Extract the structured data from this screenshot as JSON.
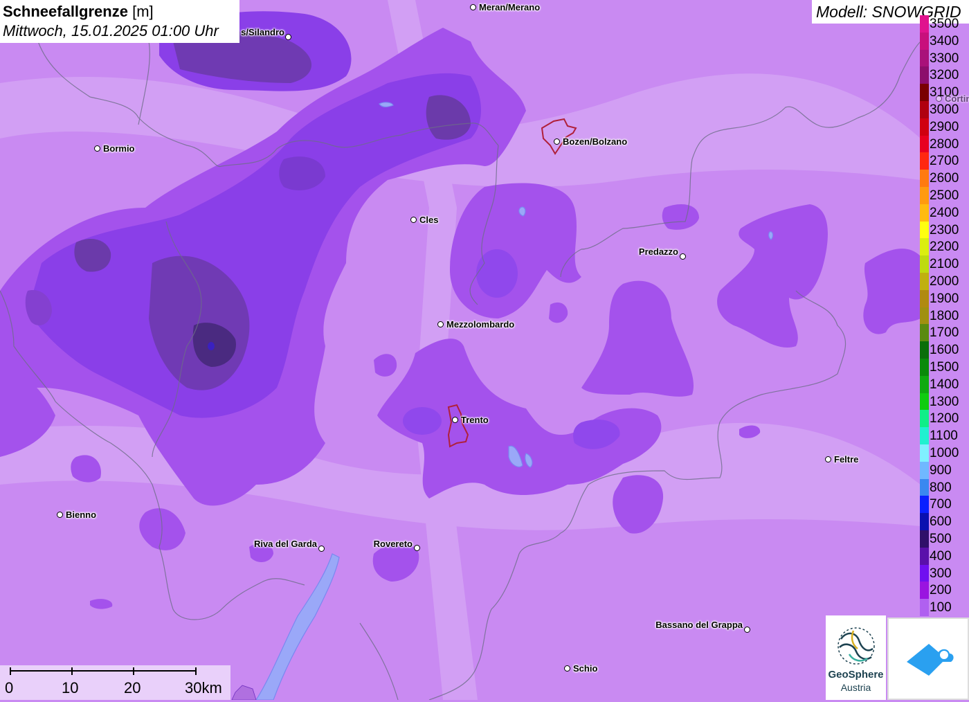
{
  "header": {
    "title_bold": "Schneefallgrenze",
    "title_unit": "[m]",
    "datetime": "Mittwoch, 15.01.2025 01:00 Uhr",
    "model": "Modell: SNOWGRID"
  },
  "legend": {
    "items": [
      {
        "label": "3500",
        "color": "#e0138e"
      },
      {
        "label": "3400",
        "color": "#c8107c"
      },
      {
        "label": "3300",
        "color": "#a9117a"
      },
      {
        "label": "3200",
        "color": "#8c0e6c"
      },
      {
        "label": "3100",
        "color": "#7a0000"
      },
      {
        "label": "3000",
        "color": "#b00010"
      },
      {
        "label": "2900",
        "color": "#d00010"
      },
      {
        "label": "2800",
        "color": "#e80020"
      },
      {
        "label": "2700",
        "color": "#ff2810"
      },
      {
        "label": "2600",
        "color": "#ff7a10"
      },
      {
        "label": "2500",
        "color": "#ff9a10"
      },
      {
        "label": "2400",
        "color": "#ffbb10"
      },
      {
        "label": "2300",
        "color": "#ffff10"
      },
      {
        "label": "2200",
        "color": "#dbee10"
      },
      {
        "label": "2100",
        "color": "#bedb10"
      },
      {
        "label": "2000",
        "color": "#c0b010"
      },
      {
        "label": "1900",
        "color": "#b08a10"
      },
      {
        "label": "1800",
        "color": "#a09010"
      },
      {
        "label": "1700",
        "color": "#5a8a10"
      },
      {
        "label": "1600",
        "color": "#0a6e0a"
      },
      {
        "label": "1500",
        "color": "#0a8a0a"
      },
      {
        "label": "1400",
        "color": "#10aa10"
      },
      {
        "label": "1300",
        "color": "#10cc10"
      },
      {
        "label": "1200",
        "color": "#10ee88"
      },
      {
        "label": "1100",
        "color": "#20f0d0"
      },
      {
        "label": "1000",
        "color": "#80f0ff"
      },
      {
        "label": "900",
        "color": "#70b8ff"
      },
      {
        "label": "800",
        "color": "#3a88f0"
      },
      {
        "label": "700",
        "color": "#0a20ff"
      },
      {
        "label": "600",
        "color": "#0a10b0"
      },
      {
        "label": "500",
        "color": "#30106a"
      },
      {
        "label": "400",
        "color": "#5a10aa"
      },
      {
        "label": "300",
        "color": "#7010f0"
      },
      {
        "label": "200",
        "color": "#9a14e0"
      },
      {
        "label": "100",
        "color": "#b060f0"
      }
    ]
  },
  "cities": [
    {
      "name": "Meran/Merano"
    },
    {
      "name": "s/Silandro"
    },
    {
      "name": "Bormio"
    },
    {
      "name": "Bozen/Bolzano"
    },
    {
      "name": "Cles"
    },
    {
      "name": "Predazzo"
    },
    {
      "name": "Mezzolombardo"
    },
    {
      "name": "Trento"
    },
    {
      "name": "Feltre"
    },
    {
      "name": "Bienno"
    },
    {
      "name": "Riva del Garda"
    },
    {
      "name": "Rovereto"
    },
    {
      "name": "Bassano del Grappa"
    },
    {
      "name": "Schio"
    },
    {
      "name": "Cortin"
    }
  ],
  "scale": {
    "labels": [
      "0",
      "10",
      "20",
      "30km"
    ]
  },
  "logos": {
    "geosphere_line1": "GeoSphere",
    "geosphere_line2": "Austria"
  },
  "colors": {
    "base_purple": "#c98af2",
    "mid_purple": "#a050ea",
    "dark_purple": "#7a3ce6",
    "deep_purple": "#4a2a90"
  }
}
